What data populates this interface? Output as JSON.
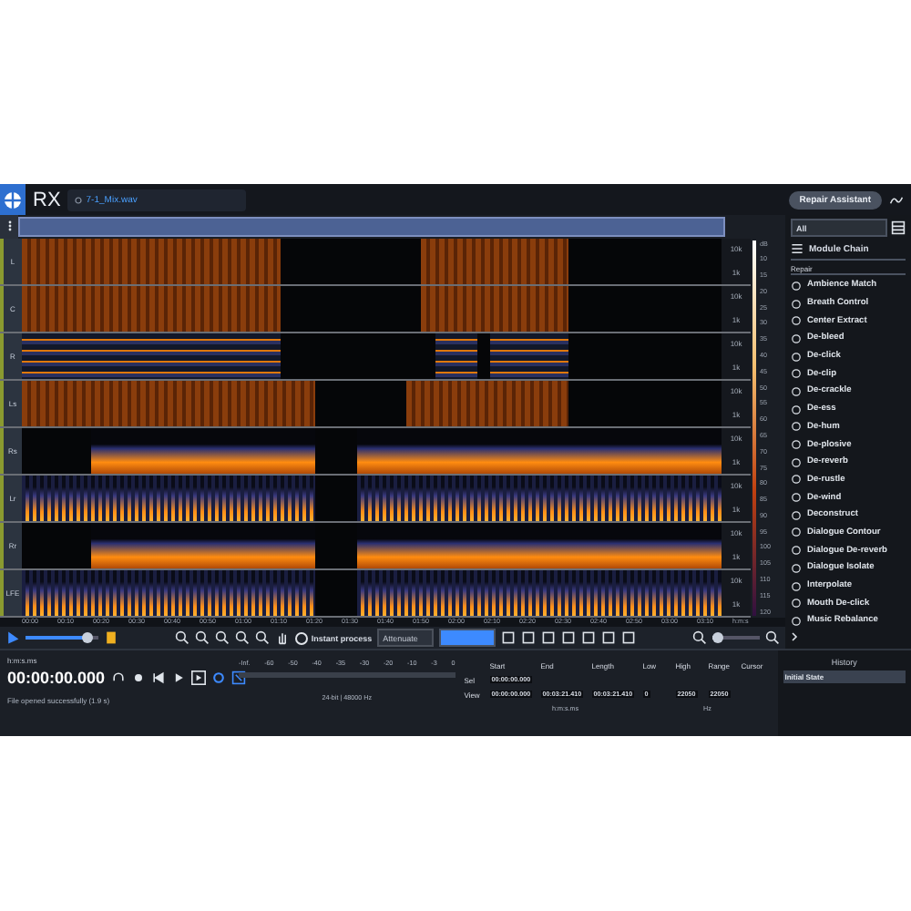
{
  "app": {
    "logo_text": "RX",
    "file_tab": "7-1_Mix.wav",
    "assistant_button": "Repair Assistant"
  },
  "channels": [
    {
      "label": "L",
      "freq_labels": [
        "10k",
        "1k"
      ]
    },
    {
      "label": "C",
      "freq_labels": [
        "10k",
        "1k"
      ]
    },
    {
      "label": "R",
      "freq_labels": [
        "10k",
        "1k"
      ]
    },
    {
      "label": "Ls",
      "freq_labels": [
        "10k",
        "1k"
      ]
    },
    {
      "label": "Rs",
      "freq_labels": [
        "10k",
        "1k"
      ]
    },
    {
      "label": "Lr",
      "freq_labels": [
        "10k",
        "1k"
      ]
    },
    {
      "label": "Rr",
      "freq_labels": [
        "10k",
        "1k"
      ]
    },
    {
      "label": "LFE",
      "freq_labels": [
        "10k",
        "1k"
      ]
    }
  ],
  "db_scale": [
    "dB",
    "10",
    "15",
    "20",
    "25",
    "30",
    "35",
    "40",
    "45",
    "50",
    "55",
    "60",
    "65",
    "70",
    "75",
    "80",
    "85",
    "90",
    "95",
    "100",
    "105",
    "110",
    "115",
    "120"
  ],
  "time_ruler": [
    "00:00",
    "00:10",
    "00:20",
    "00:30",
    "00:40",
    "00:50",
    "01:00",
    "01:10",
    "01:20",
    "01:30",
    "01:40",
    "01:50",
    "02:00",
    "02:10",
    "02:20",
    "02:30",
    "02:40",
    "02:50",
    "03:00",
    "03:10",
    "h:m:s"
  ],
  "toolbar": {
    "time_zoom": {
      "level": 0.85
    },
    "instant_process": {
      "label": "Instant process",
      "on": false
    },
    "mode_dropdown": "Attenuate",
    "freq_zoom": {
      "level": 0.1
    }
  },
  "modules_panel": {
    "filter": "All",
    "chain_label": "Module Chain",
    "group": "Repair",
    "modules": [
      "Ambience Match",
      "Breath Control",
      "Center Extract",
      "De-bleed",
      "De-click",
      "De-clip",
      "De-crackle",
      "De-ess",
      "De-hum",
      "De-plosive",
      "De-reverb",
      "De-rustle",
      "De-wind",
      "Deconstruct",
      "Dialogue Contour",
      "Dialogue De-reverb",
      "Dialogue Isolate",
      "Interpolate",
      "Mouth De-click",
      "Music Rebalance"
    ]
  },
  "transport": {
    "time_format": "h:m:s.ms",
    "timecode": "00:00:00.000"
  },
  "meter": {
    "ticks": [
      "-Inf.",
      "-60",
      "-50",
      "-40",
      "-35",
      "-30",
      "-20",
      "-10",
      "-3",
      "0"
    ]
  },
  "status": "File opened successfully (1.9 s)",
  "format": "24-bit | 48000 Hz",
  "selection": {
    "columns": [
      "Start",
      "End",
      "Length",
      "Low",
      "High",
      "Range",
      "Cursor"
    ],
    "rows": [
      {
        "label": "Sel",
        "cells": [
          "00:00:00.000"
        ]
      },
      {
        "label": "View",
        "cells": [
          "00:00:00.000",
          "00:03:21.410",
          "00:03:21.410",
          "0",
          "22050",
          "22050"
        ]
      }
    ],
    "units": [
      "h:m:s.ms",
      "Hz"
    ]
  },
  "history": {
    "title": "History",
    "items": [
      {
        "label": "Initial State",
        "selected": true
      }
    ]
  }
}
